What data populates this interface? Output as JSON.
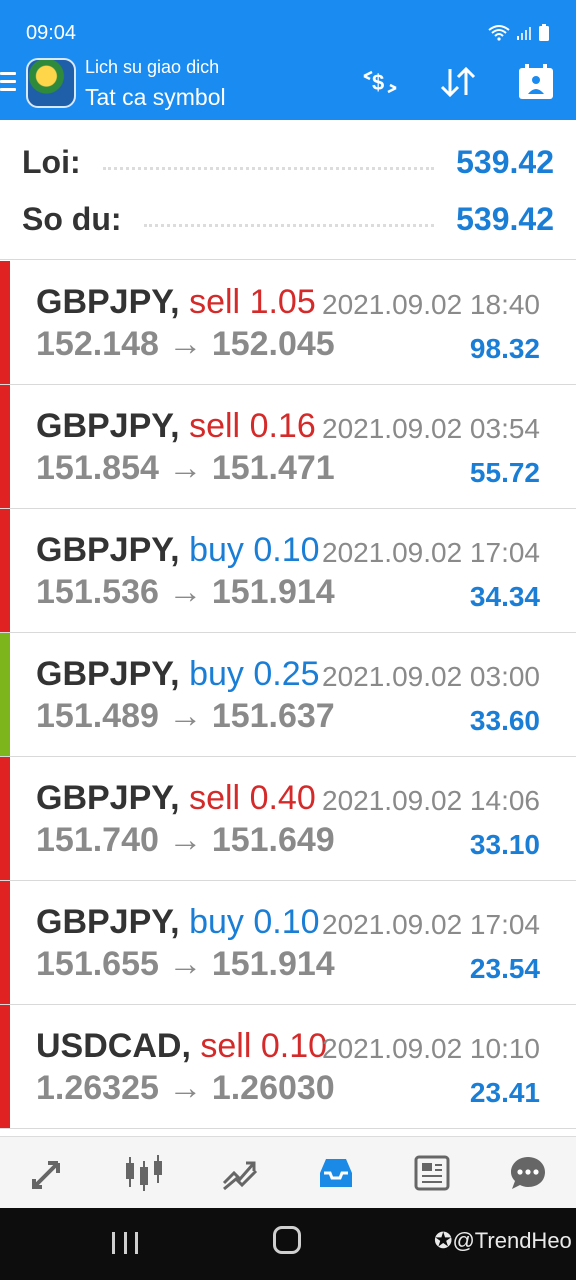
{
  "status_bar": {
    "time": "09:04"
  },
  "header": {
    "subtitle": "Lich su giao dich",
    "title": "Tat ca symbol",
    "accent": "#1a8bf0"
  },
  "summary": {
    "profit_label": "Loi:",
    "profit_value": "539.42",
    "balance_label": "So du:",
    "balance_value": "539.42"
  },
  "trades": [
    {
      "symbol": "GBPJPY,",
      "side": "sell",
      "volume": "1.05",
      "datetime": "2021.09.02 18:40",
      "open": "152.148",
      "close": "152.045",
      "profit": "98.32",
      "bar_color": "#e02222"
    },
    {
      "symbol": "GBPJPY,",
      "side": "sell",
      "volume": "0.16",
      "datetime": "2021.09.02 03:54",
      "open": "151.854",
      "close": "151.471",
      "profit": "55.72",
      "bar_color": "#e02222"
    },
    {
      "symbol": "GBPJPY,",
      "side": "buy",
      "volume": "0.10",
      "datetime": "2021.09.02 17:04",
      "open": "151.536",
      "close": "151.914",
      "profit": "34.34",
      "bar_color": "#e02222"
    },
    {
      "symbol": "GBPJPY,",
      "side": "buy",
      "volume": "0.25",
      "datetime": "2021.09.02 03:00",
      "open": "151.489",
      "close": "151.637",
      "profit": "33.60",
      "bar_color": "#7db51c"
    },
    {
      "symbol": "GBPJPY,",
      "side": "sell",
      "volume": "0.40",
      "datetime": "2021.09.02 14:06",
      "open": "151.740",
      "close": "151.649",
      "profit": "33.10",
      "bar_color": "#e02222"
    },
    {
      "symbol": "GBPJPY,",
      "side": "buy",
      "volume": "0.10",
      "datetime": "2021.09.02 17:04",
      "open": "151.655",
      "close": "151.914",
      "profit": "23.54",
      "bar_color": "#e02222"
    },
    {
      "symbol": "USDCAD,",
      "side": "sell",
      "volume": "0.10",
      "datetime": "2021.09.02 10:10",
      "open": "1.26325",
      "close": "1.26030",
      "profit": "23.41",
      "bar_color": "#e02222"
    }
  ],
  "bottom_nav": [
    {
      "icon": "quotes-arrows-icon"
    },
    {
      "icon": "candlestick-chart-icon"
    },
    {
      "icon": "trade-trend-icon"
    },
    {
      "icon": "history-inbox-icon",
      "active": true
    },
    {
      "icon": "news-icon"
    },
    {
      "icon": "chat-icon"
    }
  ],
  "watermark": "@TrendHeo"
}
